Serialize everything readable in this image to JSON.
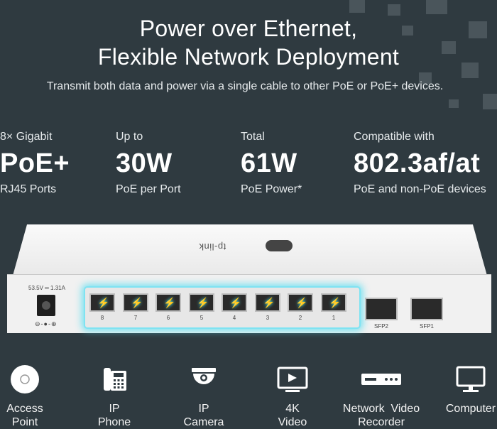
{
  "header": {
    "title_line1": "Power over Ethernet,",
    "title_line2": "Flexible Network Deployment",
    "subtitle": "Transmit both data and power via a single cable to other PoE or PoE+ devices."
  },
  "stats": [
    {
      "top": "8× Gigabit",
      "big": "PoE+",
      "bottom": "RJ45 Ports"
    },
    {
      "top": "Up to",
      "big": "30W",
      "bottom": "PoE per Port"
    },
    {
      "top": "Total",
      "big": "61W",
      "bottom": "PoE Power*"
    },
    {
      "top": "Compatible with",
      "big": "802.3af/at",
      "bottom": "PoE and non-PoE devices"
    }
  ],
  "device": {
    "brand": "tp-link",
    "power_label": "53.5V ═ 1.31A",
    "power_symbol": "⊖-●-⊕",
    "port_numbers": [
      "8",
      "7",
      "6",
      "5",
      "4",
      "3",
      "2",
      "1"
    ],
    "sfp_labels": [
      "SFP2",
      "SFP1"
    ]
  },
  "devices": [
    {
      "icon": "access-point-icon",
      "line1": "Access",
      "line2": "Point"
    },
    {
      "icon": "ip-phone-icon",
      "line1": "IP",
      "line2": "Phone"
    },
    {
      "icon": "ip-camera-icon",
      "line1": "IP",
      "line2": "Camera"
    },
    {
      "icon": "video-icon",
      "line1": "4K",
      "line2": "Video"
    },
    {
      "icon": "recorder-icon",
      "line1": "Network  Video",
      "line2": "Recorder"
    },
    {
      "icon": "computer-icon",
      "line1": "Computer",
      "line2": ""
    }
  ]
}
